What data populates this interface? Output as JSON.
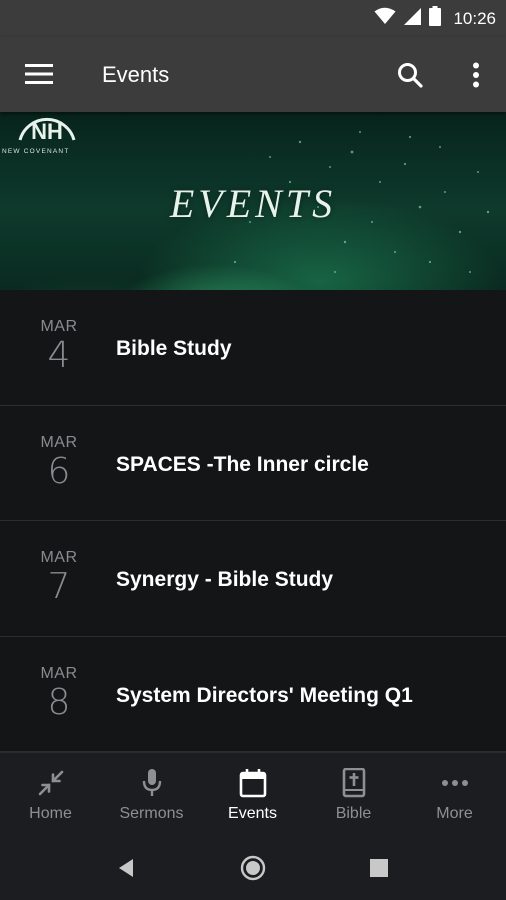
{
  "status_bar": {
    "time": "10:26"
  },
  "app_bar": {
    "title": "Events"
  },
  "banner": {
    "title": "EVENTS",
    "logo_text": "NEW COVENANT"
  },
  "events": [
    {
      "month": "MAR",
      "day": "4",
      "title": "Bible Study"
    },
    {
      "month": "MAR",
      "day": "6",
      "title": "SPACES -The Inner circle"
    },
    {
      "month": "MAR",
      "day": "7",
      "title": "Synergy - Bible Study"
    },
    {
      "month": "MAR",
      "day": "8",
      "title": "System Directors' Meeting Q1"
    }
  ],
  "bottom_nav": {
    "items": [
      {
        "label": "Home",
        "icon": "collapse-arrows-icon"
      },
      {
        "label": "Sermons",
        "icon": "microphone-icon"
      },
      {
        "label": "Events",
        "icon": "calendar-icon",
        "active": true
      },
      {
        "label": "Bible",
        "icon": "bible-icon"
      },
      {
        "label": "More",
        "icon": "more-horizontal-icon"
      }
    ]
  },
  "colors": {
    "background": "#141517",
    "app_bar": "#3c3c3c",
    "nav_bar": "#1c1d20",
    "muted_text": "#8a8b8e",
    "active_text": "#ffffff"
  }
}
